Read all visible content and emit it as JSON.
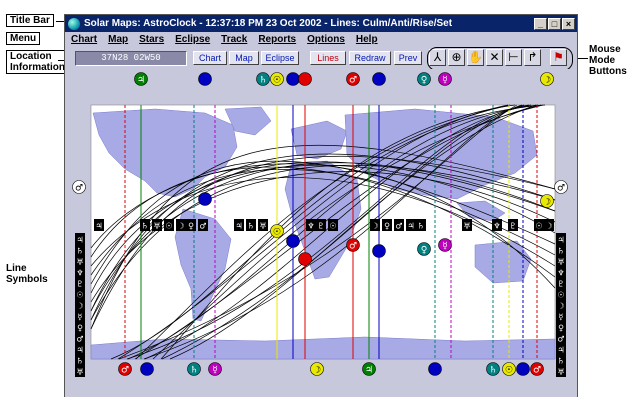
{
  "callouts": {
    "title_bar": "Title Bar",
    "menu": "Menu",
    "location_1": "Location",
    "location_2": "Information",
    "line_symbols_1": "Line",
    "line_symbols_2": "Symbols",
    "mouse_1": "Mouse",
    "mouse_2": "Mode",
    "mouse_3": "Buttons"
  },
  "window": {
    "title": "Solar Maps: AstroClock - 12:37:18 PM 23 Oct 2002 - Lines: Culm/Anti/Rise/Set",
    "minimize_glyph": "_",
    "maximize_glyph": "□",
    "close_glyph": "×"
  },
  "menu": [
    "Chart",
    "Map",
    "Stars",
    "Eclipse",
    "Track",
    "Reports",
    "Options",
    "Help"
  ],
  "toolbar": {
    "location_value": "37N28 02W50",
    "buttons": [
      "Chart",
      "Map",
      "Eclipse",
      "Lines",
      "Redraw",
      "Prev"
    ],
    "mode_buttons": [
      {
        "icon": "person-icon",
        "glyph": "⅄"
      },
      {
        "icon": "zoom-icon",
        "glyph": "⊕"
      },
      {
        "icon": "pan-icon",
        "glyph": "✋"
      },
      {
        "icon": "cross-icon",
        "glyph": "✕"
      },
      {
        "icon": "line-tool-icon",
        "glyph": "⊢"
      },
      {
        "icon": "pointer-icon",
        "glyph": "↱"
      },
      {
        "icon": "flag-icon",
        "glyph": "⚑"
      }
    ]
  },
  "colors": {
    "ocean": "#ffffff",
    "land": "#a8aae6",
    "frame": "#c8c8dc",
    "line_black": "#000000",
    "line_green": "#008000",
    "line_red": "#e00000",
    "line_blue": "#0000c0",
    "line_yellow": "#e8e800",
    "line_teal": "#008080",
    "line_magenta": "#c000c0"
  },
  "planet_glyphs": {
    "sun": "☉",
    "moon": "☽",
    "mercury": "☿",
    "venus": "♀",
    "mars": "♂",
    "jupiter": "♃",
    "saturn": "♄",
    "uranus": "♅",
    "neptune": "♆",
    "pluto": "♇"
  },
  "side_symbols": [
    "♃",
    "♄",
    "♅",
    "♆",
    "♇",
    "☉",
    "☽",
    "☿",
    "♀",
    "♂",
    "♃",
    "♄",
    "♅"
  ],
  "equator_symbols": [
    "♃",
    "♄",
    "♅",
    "☉",
    "☽",
    "♀",
    "♂",
    "♃",
    "♄",
    "♅",
    "♆",
    "♇",
    "☉",
    "☽",
    "♀",
    "♂",
    "♃",
    "♄",
    "♅",
    "♆",
    "♇",
    "☉",
    "☽"
  ]
}
